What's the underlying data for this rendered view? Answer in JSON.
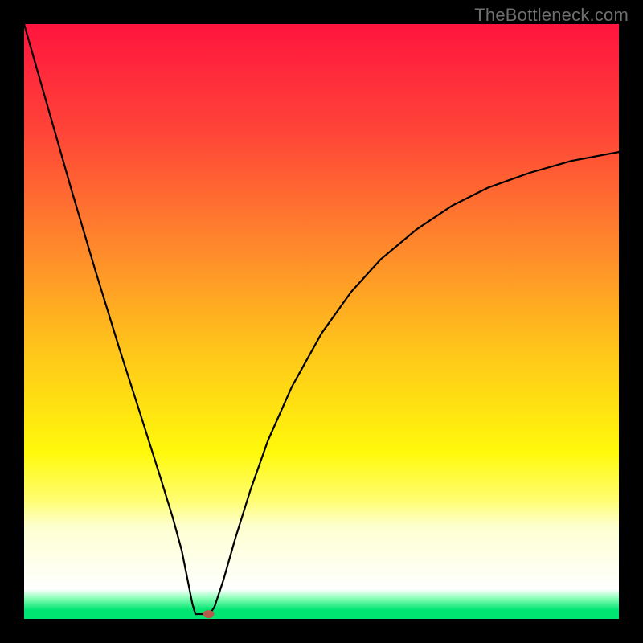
{
  "watermark": "TheBottleneck.com",
  "chart_data": {
    "type": "line",
    "title": "",
    "xlabel": "",
    "ylabel": "",
    "xlim": [
      0,
      100
    ],
    "ylim": [
      0,
      100
    ],
    "background_gradient": {
      "stops": [
        {
          "pos": 0.0,
          "color": "#ff153e"
        },
        {
          "pos": 0.18,
          "color": "#ff4438"
        },
        {
          "pos": 0.38,
          "color": "#ff8a2b"
        },
        {
          "pos": 0.55,
          "color": "#ffc61a"
        },
        {
          "pos": 0.72,
          "color": "#fff90b"
        },
        {
          "pos": 0.8,
          "color": "#fffd70"
        },
        {
          "pos": 0.845,
          "color": "#fdffd0"
        },
        {
          "pos": 0.95,
          "color": "#ffffff"
        },
        {
          "pos": 0.965,
          "color": "#8cffb9"
        },
        {
          "pos": 0.985,
          "color": "#00e571"
        },
        {
          "pos": 1.0,
          "color": "#00e571"
        }
      ]
    },
    "series": [
      {
        "name": "bottleneck-curve",
        "color": "#000000",
        "points": [
          {
            "x": 0.0,
            "y": 100.0
          },
          {
            "x": 4.0,
            "y": 86.0
          },
          {
            "x": 8.0,
            "y": 72.0
          },
          {
            "x": 12.0,
            "y": 58.5
          },
          {
            "x": 16.0,
            "y": 45.5
          },
          {
            "x": 20.0,
            "y": 33.0
          },
          {
            "x": 23.0,
            "y": 23.5
          },
          {
            "x": 25.0,
            "y": 17.0
          },
          {
            "x": 26.5,
            "y": 11.5
          },
          {
            "x": 27.5,
            "y": 6.5
          },
          {
            "x": 28.3,
            "y": 2.5
          },
          {
            "x": 28.8,
            "y": 0.8
          },
          {
            "x": 30.0,
            "y": 0.8
          },
          {
            "x": 31.2,
            "y": 0.8
          },
          {
            "x": 32.0,
            "y": 2.0
          },
          {
            "x": 33.5,
            "y": 6.5
          },
          {
            "x": 35.5,
            "y": 13.5
          },
          {
            "x": 38.0,
            "y": 21.5
          },
          {
            "x": 41.0,
            "y": 30.0
          },
          {
            "x": 45.0,
            "y": 39.0
          },
          {
            "x": 50.0,
            "y": 48.0
          },
          {
            "x": 55.0,
            "y": 55.0
          },
          {
            "x": 60.0,
            "y": 60.5
          },
          {
            "x": 66.0,
            "y": 65.5
          },
          {
            "x": 72.0,
            "y": 69.5
          },
          {
            "x": 78.0,
            "y": 72.5
          },
          {
            "x": 85.0,
            "y": 75.0
          },
          {
            "x": 92.0,
            "y": 77.0
          },
          {
            "x": 100.0,
            "y": 78.5
          }
        ]
      }
    ],
    "marker": {
      "x": 31.0,
      "y": 0.8,
      "color": "#b55a4a"
    }
  }
}
